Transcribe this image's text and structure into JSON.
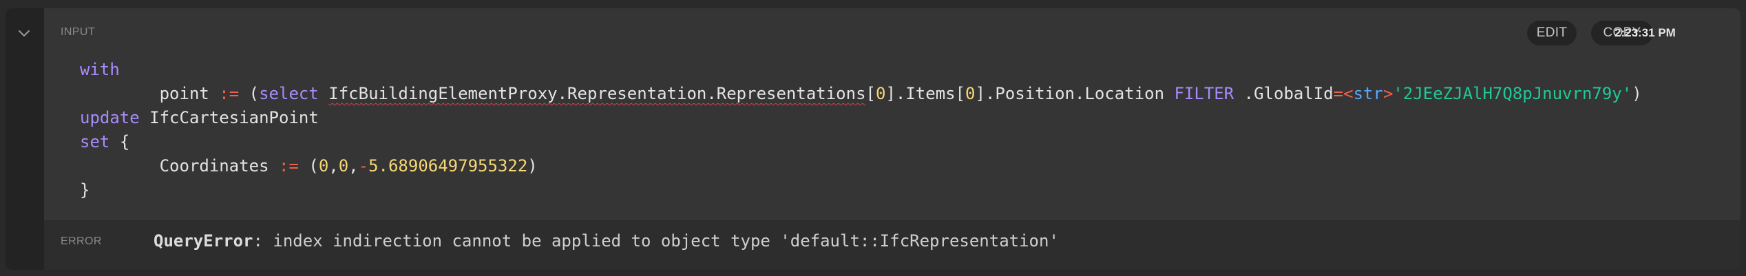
{
  "header": {
    "section_label": "INPUT",
    "edit_label": "EDIT",
    "copy_label": "COPY",
    "timestamp": "2:23:31 PM"
  },
  "query": {
    "kw_with": "with",
    "var_point": "point",
    "op_assign": ":=",
    "paren_open": "(",
    "kw_select": "select",
    "path_error_part": "IfcBuildingElementProxy.Representation.Representations",
    "bracket_open": "[",
    "index0": "0",
    "bracket_close": "]",
    "items_part": ".Items",
    "index1": "0",
    "position_part": ".Position.Location",
    "kw_filter": "FILTER",
    "globalid_part": ".GlobalId",
    "op_eq": "=",
    "cast_open": "<",
    "cast_type": "str",
    "cast_close": ">",
    "global_id_value": "'2JEeZJAlH7Q8pJnuvrn79y'",
    "paren_close": ")",
    "kw_update": "update",
    "target_type": "IfcCartesianPoint",
    "kw_set": "set",
    "brace_open": "{",
    "field_coordinates": "Coordinates",
    "coord_x": "0",
    "coord_y": "0",
    "coord_minus": "-",
    "coord_z": "5.68906497955322",
    "brace_close": "}"
  },
  "error": {
    "section_label": "ERROR",
    "type": "QueryError",
    "message": ": index indirection cannot be applied to object type 'default::IfcRepresentation'"
  },
  "colors": {
    "keyword": "#a78bfa",
    "operator": "#f25f4c",
    "number": "#f7d774",
    "string": "#20c997",
    "type": "#58a6ff"
  }
}
